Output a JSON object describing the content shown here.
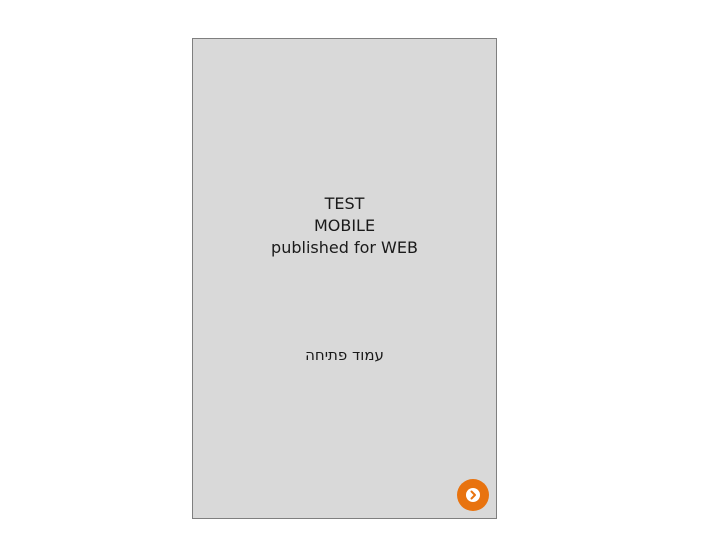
{
  "page": {
    "title_lines": [
      "TEST",
      "MOBILE",
      "published for WEB"
    ],
    "subtitle": "עמוד פתיחה"
  },
  "controls": {
    "next_button": {
      "icon": "chevron-right-circle-icon",
      "color": "#e8730f"
    }
  },
  "colors": {
    "card_background": "#d9d9d9",
    "card_border": "#7f7f7f",
    "accent": "#e8730f"
  }
}
